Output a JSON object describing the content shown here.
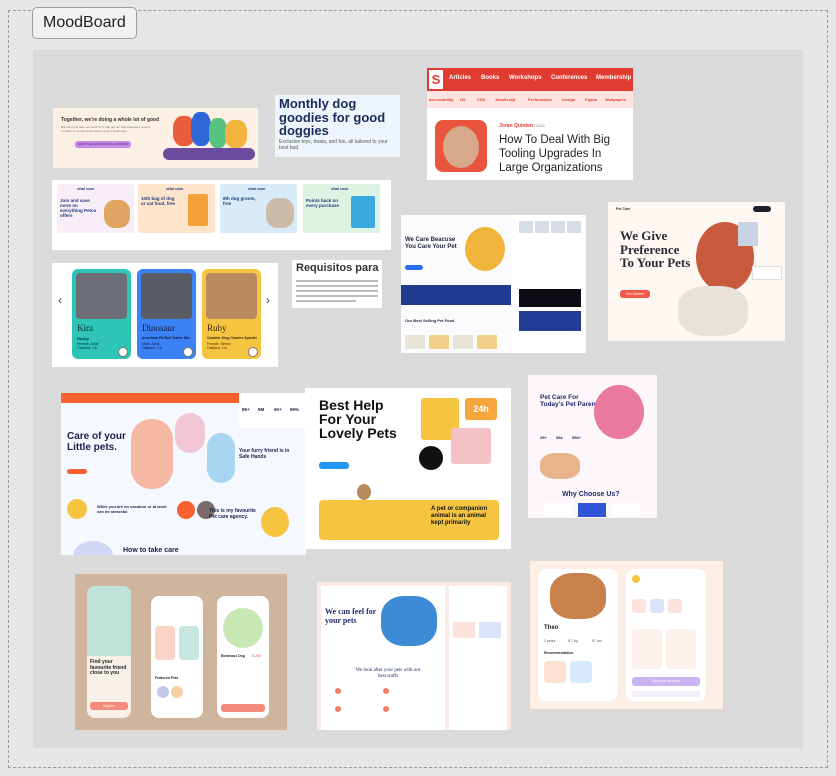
{
  "board": {
    "title": "MoodBoard",
    "colors": {
      "background": "#dadada",
      "canvas": "#e6e6e6"
    }
  },
  "cards": {
    "together": {
      "headline": "Together, we're doing a whole lot of good",
      "body": "But don't just take our word for it. We get our dog-obsessed experts to share more about the power of your purchases.",
      "cta": "SHOP THE GOOD DOING CONTENT"
    },
    "monthly": {
      "headline": "Monthly dog goodies for good doggies",
      "sub": "Exclusive toys, treats, and fun, all tailored to your best bud."
    },
    "smashing": {
      "logo": "S",
      "nav": [
        "Articles",
        "Books",
        "Workshops",
        "Conferences",
        "Membership"
      ],
      "tags": [
        "Accessibility",
        "UX",
        "CSS",
        "JavaScript",
        "Performance",
        "Design",
        "Figma",
        "Wallpapers"
      ],
      "author": "Joran Quinten",
      "date": "7/7/2023",
      "title": "How To Deal With Big Tooling Upgrades In Large Organizations"
    },
    "vitalcare": {
      "tiles": [
        {
          "brand": "vital care",
          "title": "Join and save more on everything Petco offers"
        },
        {
          "brand": "vital care",
          "title": "10th bag of dog or cat food, free"
        },
        {
          "brand": "vital care",
          "title": "8th dog groom, free"
        },
        {
          "brand": "vital care",
          "title": "Points back on every purchase"
        }
      ]
    },
    "carousel": {
      "dogs": [
        {
          "name": "Kira",
          "breed": "Husky",
          "info": "Female, Adult Oakland, CA"
        },
        {
          "name": "Dinosaur",
          "breed": "American Pit Bull Terrier Mix",
          "info": "Male, Adult Oakland, CA"
        },
        {
          "name": "Ruby",
          "breed": "Cavalier King Charles Spaniel",
          "info": "Female, Senior Oakland, CA"
        }
      ],
      "prev": "‹",
      "next": "›"
    },
    "requisitos": {
      "heading": "Requisitos para"
    },
    "petcare_lp": {
      "headline": "We Care Beacuse You Care Your Pet",
      "section": "Our Best Selling Pet Food"
    },
    "preference": {
      "logo": "Pet Care",
      "headline": "We Give Preference To Your Pets",
      "cta": "Get Started"
    },
    "little_pets": {
      "headline": "Care of your Little pets.",
      "section1": "Your furry friend is in Safe Hands",
      "section2": "This is my favourite Pet care agency.",
      "section3": "While you are on vacation or at work can be stressful",
      "footer": "How to take care",
      "stats": [
        "85+",
        "9M",
        "60+",
        "99%"
      ]
    },
    "best_help": {
      "headline": "Best Help For Your Lovely Pets",
      "badge": "24h",
      "strip_text": "A pet or companion animal is an animal kept primarily"
    },
    "todays_parents": {
      "headline": "Pet Care For Today's Pet Parents",
      "why": "Why Choose Us?",
      "stats": [
        "25+",
        "36k",
        "55k+"
      ]
    },
    "mobile_app": {
      "headline": "Find your favourite friend close to you",
      "section": "Featured Pets",
      "cta": "Explore",
      "pet_name": "Bordeaux Dog",
      "price": "$ 250"
    },
    "feel_for_pets": {
      "headline": "We can feel for your pets",
      "sub": "We look after your pets with our best staffs"
    },
    "dog_app": {
      "pet_name": "Theo",
      "stats": [
        "2 years",
        "5.7 kg",
        "57 cm"
      ],
      "section": "Recommendation",
      "cta": "Book pet services"
    }
  }
}
